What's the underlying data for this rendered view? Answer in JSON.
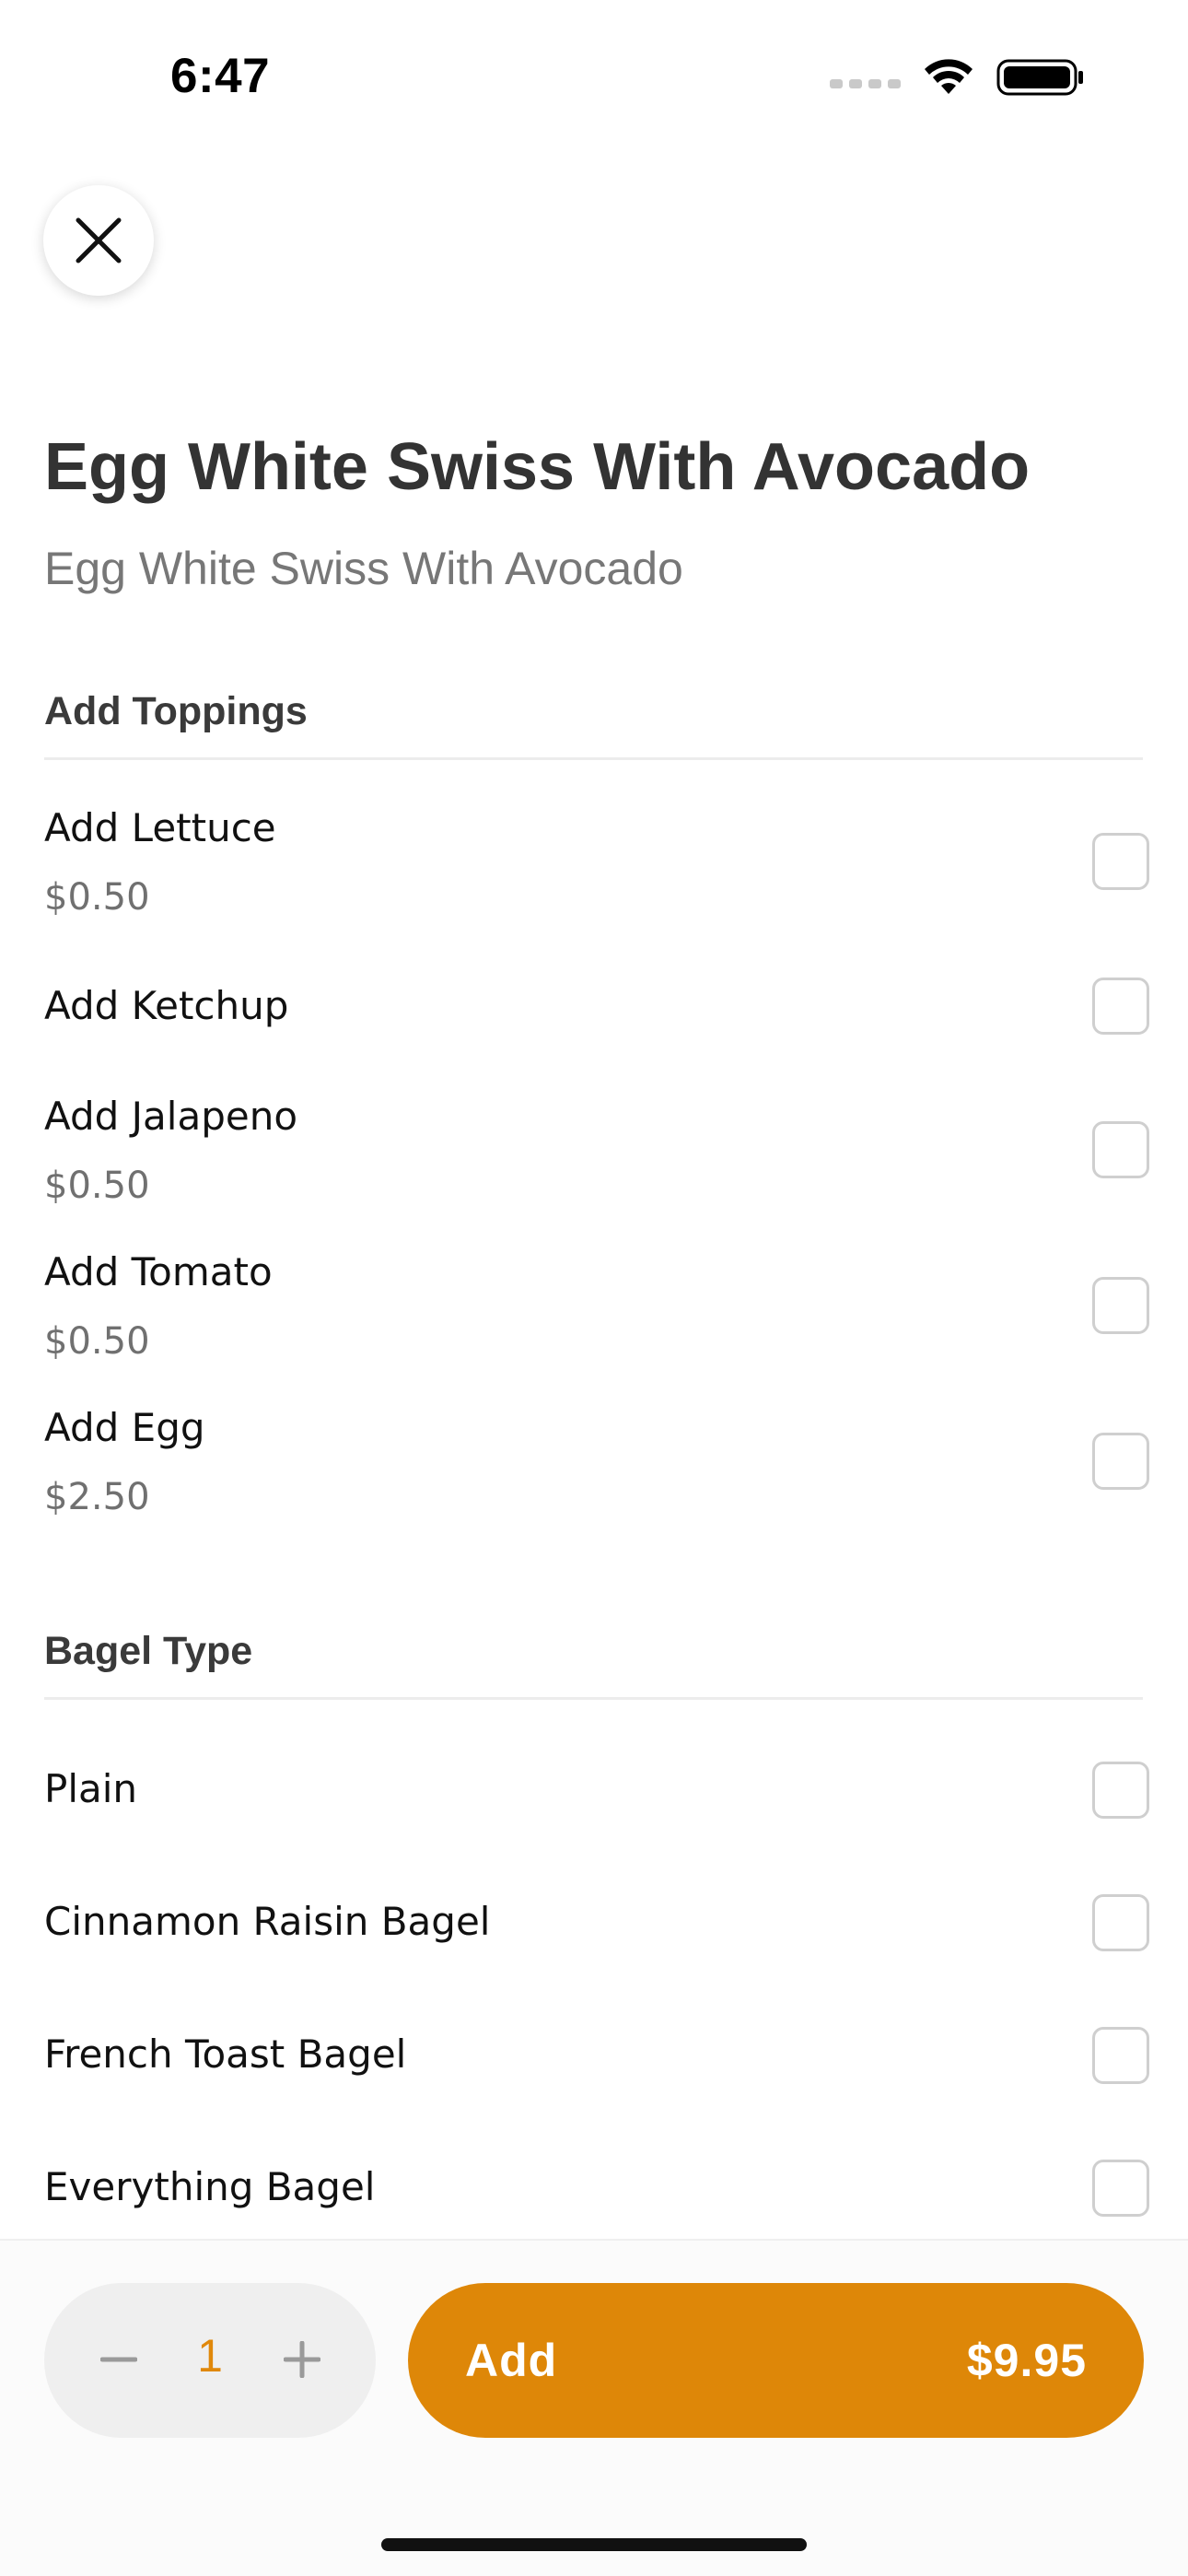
{
  "status_bar": {
    "time": "6:47"
  },
  "item": {
    "title": "Egg White Swiss With Avocado",
    "subtitle": "Egg White Swiss With Avocado"
  },
  "sections": {
    "toppings": {
      "title": "Add Toppings",
      "options": [
        {
          "label": "Add Lettuce",
          "price": "$0.50",
          "checked": false
        },
        {
          "label": "Add Ketchup",
          "price": "",
          "checked": false
        },
        {
          "label": "Add Jalapeno",
          "price": "$0.50",
          "checked": false
        },
        {
          "label": "Add Tomato",
          "price": "$0.50",
          "checked": false
        },
        {
          "label": "Add Egg",
          "price": "$2.50",
          "checked": false
        }
      ]
    },
    "bagel": {
      "title": "Bagel Type",
      "options": [
        {
          "label": "Plain",
          "checked": false
        },
        {
          "label": "Cinnamon Raisin Bagel",
          "checked": false
        },
        {
          "label": "French Toast Bagel",
          "checked": false
        },
        {
          "label": "Everything Bagel",
          "checked": false
        }
      ]
    }
  },
  "footer": {
    "quantity": "1",
    "add_label": "Add",
    "total": "$9.95"
  },
  "colors": {
    "accent": "#de8708",
    "quantity": "#e0880a"
  },
  "icons": {
    "close": "close-icon",
    "minus": "minus-icon",
    "plus": "plus-icon"
  }
}
